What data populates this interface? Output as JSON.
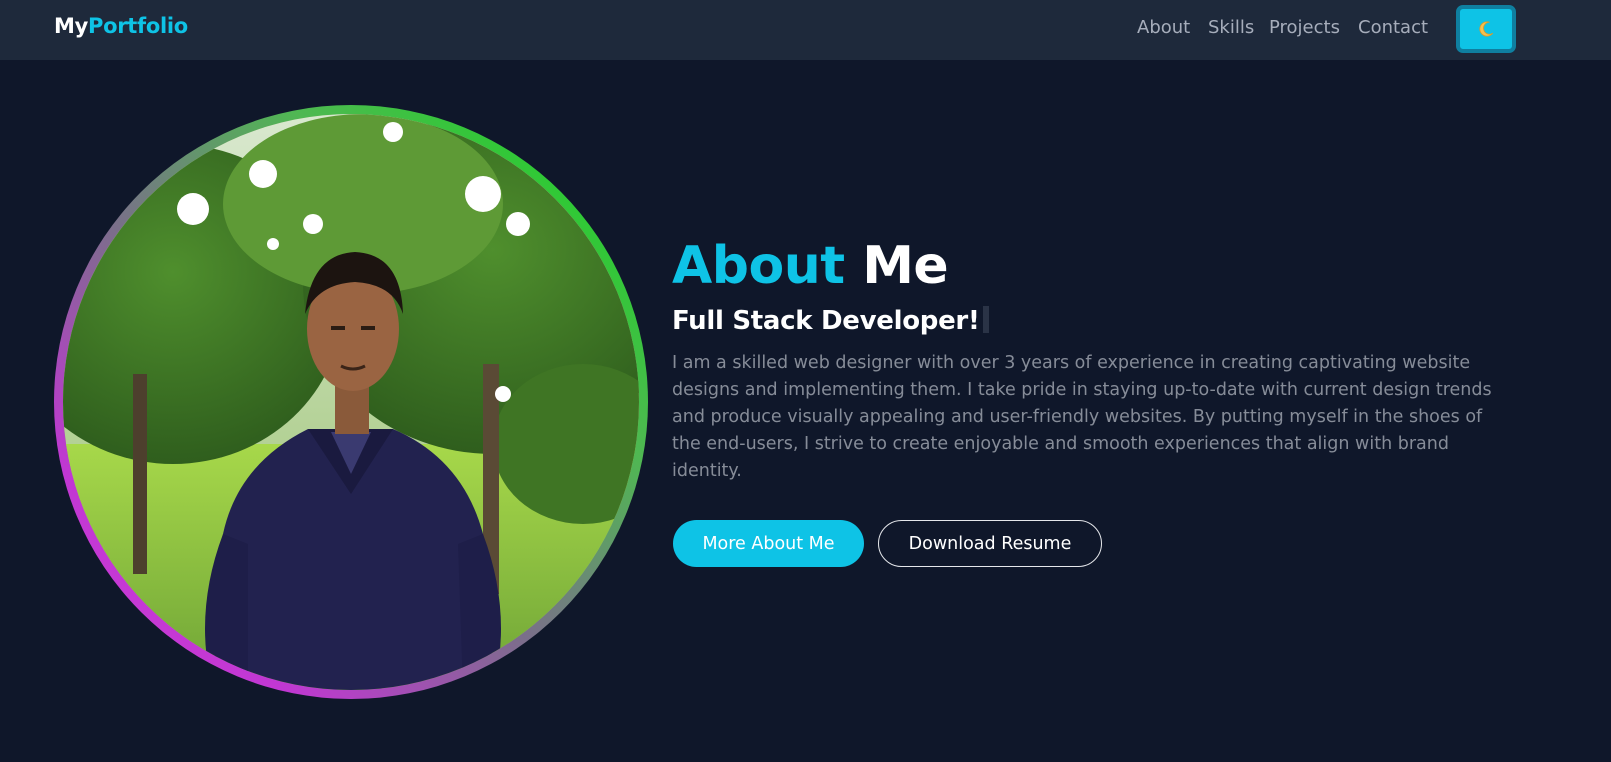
{
  "navbar": {
    "logo": {
      "part1": "My",
      "part2": "Portfolio"
    },
    "links": [
      {
        "label": "About"
      },
      {
        "label": "Skills"
      },
      {
        "label": "Projects"
      },
      {
        "label": "Contact"
      }
    ],
    "theme_toggle": {
      "icon": "moon-icon",
      "glyph": "🌙"
    }
  },
  "hero": {
    "photo": {
      "description": "profile-photo"
    },
    "heading": {
      "part1": "About",
      "part2": "Me"
    },
    "subtitle": "Full Stack Developer!",
    "bio": "I am a skilled web designer with over 3 years of experience in creating captivating website designs and implementing them. I take pride in staying up-to-date with current design trends and produce visually appealing and user-friendly websites. By putting myself in the shoes of the end-users, I strive to create enjoyable and smooth experiences that align with brand identity.",
    "buttons": {
      "primary": "More About Me",
      "secondary": "Download Resume"
    }
  },
  "colors": {
    "background": "#0f172a",
    "navbar": "#1e293b",
    "accent": "#0ec3e6",
    "text_muted": "#868c98",
    "ring_start": "#12d81a",
    "ring_end": "#d23ed8"
  }
}
